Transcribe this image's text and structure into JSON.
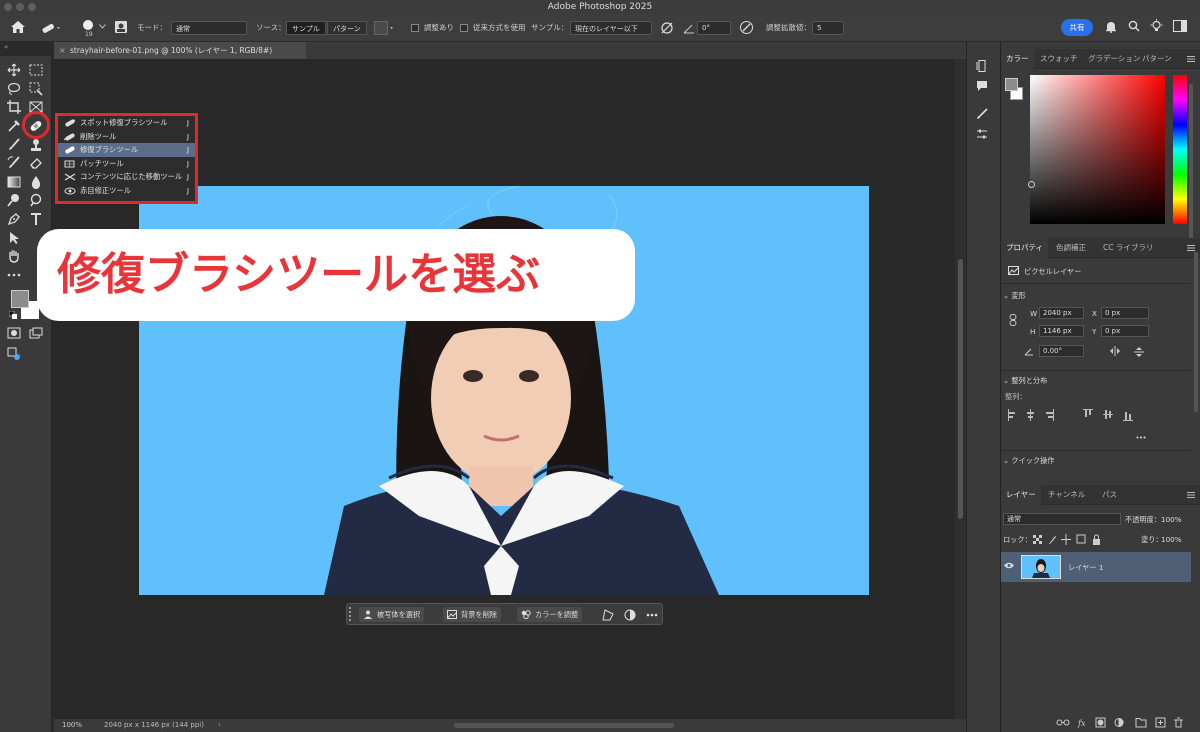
{
  "app": {
    "title": "Adobe Photoshop 2025"
  },
  "options_bar": {
    "brush_size": "19",
    "mode_label": "モード：",
    "mode_value": "通常",
    "source_label": "ソース：",
    "source_sample": "サンプル",
    "source_pattern": "パターン",
    "aligned_label": "調整あり",
    "legacy_label": "従来方式を使用",
    "sample_label": "サンプル：",
    "sample_value": "現在のレイヤー以下",
    "angle_value": "0°",
    "diffusion_label": "調整拡散値：",
    "diffusion_value": "5",
    "share_label": "共有"
  },
  "document": {
    "tab_title": "strayhair-before-01.png @ 100% (レイヤー 1, RGB/8#)"
  },
  "flyout": {
    "items": [
      {
        "label": "スポット修復ブラシツール",
        "key": "J"
      },
      {
        "label": "削除ツール",
        "key": "J"
      },
      {
        "label": "修復ブラシツール",
        "key": "J",
        "selected": true
      },
      {
        "label": "パッチツール",
        "key": "J"
      },
      {
        "label": "コンテンツに応じた移動ツール",
        "key": "J"
      },
      {
        "label": "赤目修正ツール",
        "key": "J"
      }
    ]
  },
  "callout": {
    "text": "修復ブラシツールを選ぶ",
    "color": "#e8353a"
  },
  "contextual_bar": {
    "select_subject": "被写体を選択",
    "remove_bg": "背景を削除",
    "adjust_color": "カラーを調整"
  },
  "status": {
    "zoom": "100%",
    "doc_info": "2040 px x 1146 px (144 ppi)"
  },
  "color_panel": {
    "tabs": [
      "カラー",
      "スウォッチ",
      "グラデーション",
      "パターン"
    ]
  },
  "properties_panel": {
    "tabs": [
      "プロパティ",
      "色調補正",
      "CC ライブラリ"
    ],
    "layer_type": "ピクセルレイヤー",
    "transform_title": "変形",
    "w_label": "W",
    "w_value": "2040 px",
    "x_label": "X",
    "x_value": "0 px",
    "h_label": "H",
    "h_value": "1146 px",
    "y_label": "Y",
    "y_value": "0 px",
    "angle_value": "0.00°",
    "align_title": "整列と分布",
    "align_label": "整列：",
    "quick_actions_title": "クイック操作"
  },
  "layers_panel": {
    "tabs": [
      "レイヤー",
      "チャンネル",
      "パス"
    ],
    "blend_mode": "通常",
    "opacity_label": "不透明度：",
    "opacity_value": "100%",
    "lock_label": "ロック：",
    "fill_label": "塗り：",
    "fill_value": "100%",
    "layer_name": "レイヤー 1"
  },
  "colors": {
    "accent": "#2a70e8",
    "highlight": "#e02a2a",
    "photo_bg": "#5fc0fb",
    "panel": "#3a3a3a"
  }
}
